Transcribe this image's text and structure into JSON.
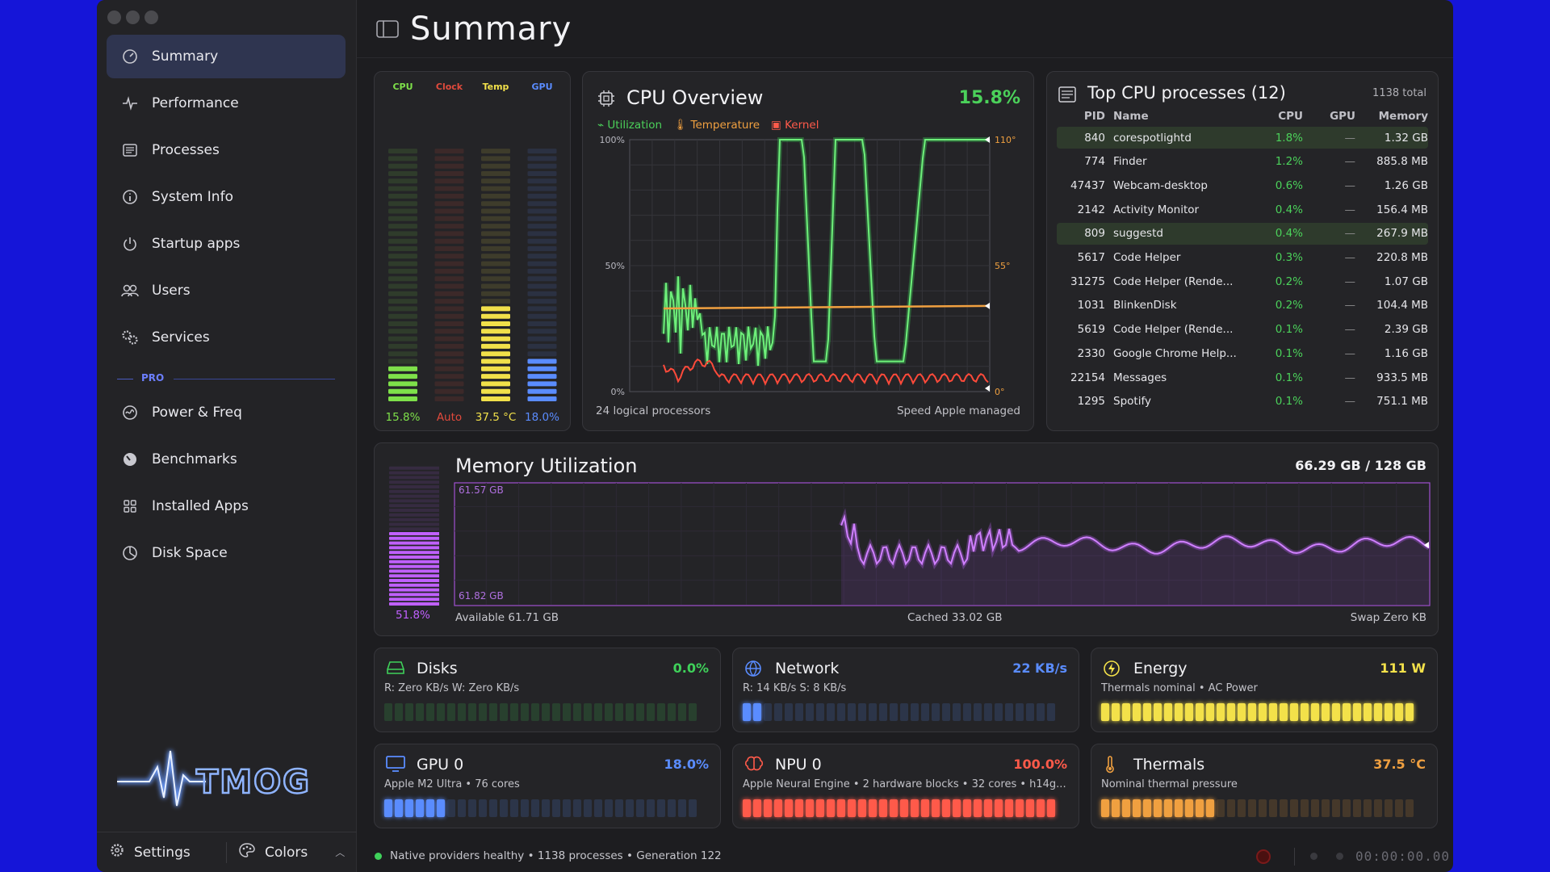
{
  "sidebar": {
    "items": [
      {
        "label": "Summary",
        "icon": "gauge-icon",
        "active": true
      },
      {
        "label": "Performance",
        "icon": "activity-icon"
      },
      {
        "label": "Processes",
        "icon": "list-icon"
      },
      {
        "label": "System Info",
        "icon": "info-icon"
      },
      {
        "label": "Startup apps",
        "icon": "power-icon"
      },
      {
        "label": "Users",
        "icon": "users-icon"
      },
      {
        "label": "Services",
        "icon": "gears-icon"
      }
    ],
    "section_label": "PRO",
    "pro_items": [
      {
        "label": "Power & Freq",
        "icon": "wave-gauge-icon"
      },
      {
        "label": "Benchmarks",
        "icon": "speedometer-icon"
      },
      {
        "label": "Installed Apps",
        "icon": "grid-icon"
      },
      {
        "label": "Disk Space",
        "icon": "pie-icon"
      }
    ],
    "logo_text": "TMOG",
    "footer": {
      "settings": "Settings",
      "colors": "Colors"
    }
  },
  "header": {
    "title": "Summary"
  },
  "meters": {
    "labels": [
      "CPU",
      "Clock",
      "Temp",
      "GPU"
    ],
    "values": [
      "15.8%",
      "Auto",
      "37.5 °C",
      "18.0%"
    ],
    "levels": [
      0.158,
      0,
      0.37,
      0.18
    ],
    "colors": [
      "#7ee04a",
      "#e14a3c",
      "#f1e04a",
      "#5a8cff"
    ]
  },
  "cpu_overview": {
    "title": "CPU Overview",
    "value": "15.8%",
    "legend": [
      "Utilization",
      "Temperature",
      "Kernel"
    ],
    "left_ticks": [
      "100%",
      "50%",
      "0%"
    ],
    "right_ticks": [
      "110°",
      "55°",
      "0°"
    ],
    "footer_left": "24 logical processors",
    "footer_right": "Speed Apple managed"
  },
  "top_processes": {
    "title": "Top CPU processes (12)",
    "total": "1138 total",
    "columns": [
      "PID",
      "Name",
      "CPU",
      "GPU",
      "Memory"
    ],
    "rows": [
      {
        "pid": "840",
        "name": "corespotlightd",
        "cpu": "1.8%",
        "gpu": "—",
        "mem": "1.32 GB",
        "hl": true
      },
      {
        "pid": "774",
        "name": "Finder",
        "cpu": "1.2%",
        "gpu": "—",
        "mem": "885.8 MB"
      },
      {
        "pid": "47437",
        "name": "Webcam-desktop",
        "cpu": "0.6%",
        "gpu": "—",
        "mem": "1.26 GB"
      },
      {
        "pid": "2142",
        "name": "Activity Monitor",
        "cpu": "0.4%",
        "gpu": "—",
        "mem": "156.4 MB"
      },
      {
        "pid": "809",
        "name": "suggestd",
        "cpu": "0.4%",
        "gpu": "—",
        "mem": "267.9 MB",
        "hl": true
      },
      {
        "pid": "5617",
        "name": "Code Helper",
        "cpu": "0.3%",
        "gpu": "—",
        "mem": "220.8 MB"
      },
      {
        "pid": "31275",
        "name": "Code Helper (Rende...",
        "cpu": "0.2%",
        "gpu": "—",
        "mem": "1.07 GB"
      },
      {
        "pid": "1031",
        "name": "BlinkenDisk",
        "cpu": "0.2%",
        "gpu": "—",
        "mem": "104.4 MB"
      },
      {
        "pid": "5619",
        "name": "Code Helper (Rende...",
        "cpu": "0.1%",
        "gpu": "—",
        "mem": "2.39 GB"
      },
      {
        "pid": "2330",
        "name": "Google Chrome Help...",
        "cpu": "0.1%",
        "gpu": "—",
        "mem": "1.16 GB"
      },
      {
        "pid": "22154",
        "name": "Messages",
        "cpu": "0.1%",
        "gpu": "—",
        "mem": "933.5 MB"
      },
      {
        "pid": "1295",
        "name": "Spotify",
        "cpu": "0.1%",
        "gpu": "—",
        "mem": "751.1 MB"
      }
    ]
  },
  "memory": {
    "title": "Memory Utilization",
    "value": "66.29 GB / 128 GB",
    "percent": "51.8%",
    "level": 0.518,
    "top_label": "61.57 GB",
    "bottom_label": "61.82 GB",
    "available": "Available 61.71 GB",
    "cached": "Cached 33.02 GB",
    "swap": "Swap Zero KB"
  },
  "tiles": [
    {
      "title": "Disks",
      "value": "0.0%",
      "sub": "R: Zero KB/s  W: Zero KB/s",
      "color": "#3fd15a",
      "level": 0,
      "icon": "disk-icon"
    },
    {
      "title": "Network",
      "value": "22 KB/s",
      "sub": "R: 14 KB/s  S: 8 KB/s",
      "color": "#5a8cff",
      "level": 0.08,
      "icon": "globe-icon"
    },
    {
      "title": "Energy",
      "value": "111 W",
      "sub": "Thermals nominal • AC Power",
      "color": "#f3e14a",
      "level": 1,
      "icon": "bolt-icon"
    },
    {
      "title": "GPU 0",
      "value": "18.0%",
      "sub": "Apple M2 Ultra • 76 cores",
      "color": "#5a8cff",
      "level": 0.2,
      "icon": "monitor-icon"
    },
    {
      "title": "NPU 0",
      "value": "100.0%",
      "sub": "Apple Neural Engine • 2 hardware blocks • 32 cores • h14g...",
      "color": "#ff5a4a",
      "level": 1,
      "icon": "brain-icon"
    },
    {
      "title": "Thermals",
      "value": "37.5 °C",
      "sub": "Nominal thermal pressure",
      "color": "#f0a040",
      "level": 0.37,
      "icon": "thermometer-icon"
    }
  ],
  "status": {
    "text": "Native providers healthy • 1138 processes • Generation 122",
    "timer": "00:00:00.00"
  }
}
